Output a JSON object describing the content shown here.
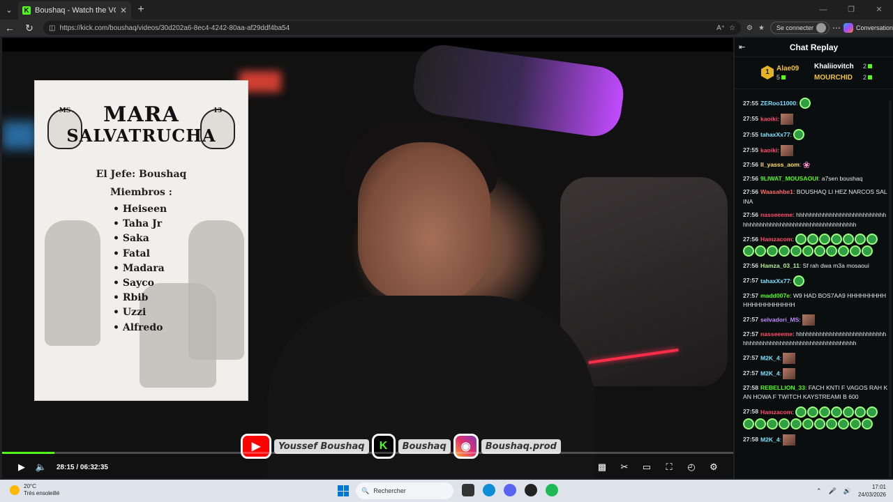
{
  "browser": {
    "tab_title": "Boushaq - Watch the VOD on Kick",
    "tab_favicon": "K",
    "url": "https://kick.com/boushaq/videos/30d202a6-8ec4-4242-80aa-af29ddf4ba54",
    "signin_label": "Se connecter",
    "copilot_label": "Conversation"
  },
  "poster": {
    "title_line1": "MARA",
    "title_line2": "SALVATRUCHA",
    "tag_left": "MS",
    "tag_right": "13",
    "jefe": "El Jefe: Boushaq",
    "miembros_label": "Miembros :",
    "members": [
      "Heiseen",
      "Taha Jr",
      "Saka",
      "Fatal",
      "Madara",
      "Sayco",
      "Rbib",
      "Uzzi",
      "Alfredo"
    ]
  },
  "social": {
    "youtube": "Youssef Boushaq",
    "kick": "Boushaq",
    "instagram": "Boushaq.prod"
  },
  "player": {
    "current_time": "28:15",
    "duration": "06:32:35",
    "time_display": "28:15 / 06:32:35",
    "progress_fraction": 0.072
  },
  "chat": {
    "title": "Chat Replay",
    "leaderboard": [
      {
        "rank": "1",
        "name": "Alae09",
        "count": "5"
      },
      {
        "name": "Khaliiovitch",
        "count": "2"
      },
      {
        "name": "MOURCHID",
        "count": "2"
      }
    ],
    "messages": [
      {
        "time": "27:55",
        "user": "ZERoo11000",
        "color": "#7ee0ff",
        "text": "",
        "emotes": "green"
      },
      {
        "time": "27:55",
        "user": "kaoiki",
        "color": "#ff4d6d",
        "text": "",
        "emotes": "img"
      },
      {
        "time": "27:55",
        "user": "tahaxXx77",
        "color": "#7ee0ff",
        "text": "",
        "emotes": "green"
      },
      {
        "time": "27:55",
        "user": "kaoiki",
        "color": "#ff4d6d",
        "text": "",
        "emotes": "img"
      },
      {
        "time": "27:56",
        "user": "ll_yasss_aom",
        "color": "#ffe066",
        "text": "",
        "emotes": "bow"
      },
      {
        "time": "27:56",
        "user": "9LIWAT_MOUSAOUI",
        "color": "#53fc18",
        "text": "a7sen boushaq",
        "emotes": ""
      },
      {
        "time": "27:56",
        "user": "Waasahbe1",
        "color": "#ff6b6b",
        "text": "BOUSHAQ LI HEZ NARCOS SALINA",
        "emotes": ""
      },
      {
        "time": "27:56",
        "user": "nasseeeme",
        "color": "#ff4d6d",
        "text": "hhhhhhhhhhhhhhhhhhhhhhhhhhhhhhhhhhhhhhhhhhhhhhhhhhhhhhhhhhhhh",
        "emotes": ""
      },
      {
        "time": "27:56",
        "user": "Hamzacom",
        "color": "#ff4d6d",
        "text": "",
        "emotes": "green18"
      },
      {
        "time": "27:56",
        "user": "Hamza_03_11",
        "color": "#b6f09c",
        "text": "Sf rah dwa m3a mosaoui",
        "emotes": ""
      },
      {
        "time": "27:57",
        "user": "tahaxXx77",
        "color": "#7ee0ff",
        "text": "",
        "emotes": "green"
      },
      {
        "time": "27:57",
        "user": "madd007e",
        "color": "#53fc18",
        "text": "W9 HAD BOS7AA9 HHHHHHHHHHHHHHHHHHHHH",
        "emotes": ""
      },
      {
        "time": "27:57",
        "user": "selvadori_MS",
        "color": "#c18bff",
        "text": "",
        "emotes": "img"
      },
      {
        "time": "27:57",
        "user": "nasseeeme",
        "color": "#ff4d6d",
        "text": "hhhhhhhhhhhhhhhhhhhhhhhhhhhhhhhhhhhhhhhhhhhhhhhhhhhhhhhhhhhhh",
        "emotes": ""
      },
      {
        "time": "27:57",
        "user": "M2K_4",
        "color": "#7ee0ff",
        "text": "",
        "emotes": "img"
      },
      {
        "time": "27:57",
        "user": "M2K_4",
        "color": "#7ee0ff",
        "text": "",
        "emotes": "img"
      },
      {
        "time": "27:58",
        "user": "REBELLION_33",
        "color": "#53fc18",
        "text": "FACH KNTI F VAGOS RAH KAN HOWA F TWITCH KAYSTREAMI B 600",
        "emotes": ""
      },
      {
        "time": "27:58",
        "user": "Hamzacom",
        "color": "#ff4d6d",
        "text": "",
        "emotes": "green18"
      },
      {
        "time": "27:58",
        "user": "M2K_4",
        "color": "#7ee0ff",
        "text": "",
        "emotes": "img"
      }
    ]
  },
  "taskbar": {
    "temperature": "20°C",
    "weather": "Très ensoleillé",
    "search_label": "Rechercher",
    "time": "17:01",
    "date": "24/03/2026"
  }
}
